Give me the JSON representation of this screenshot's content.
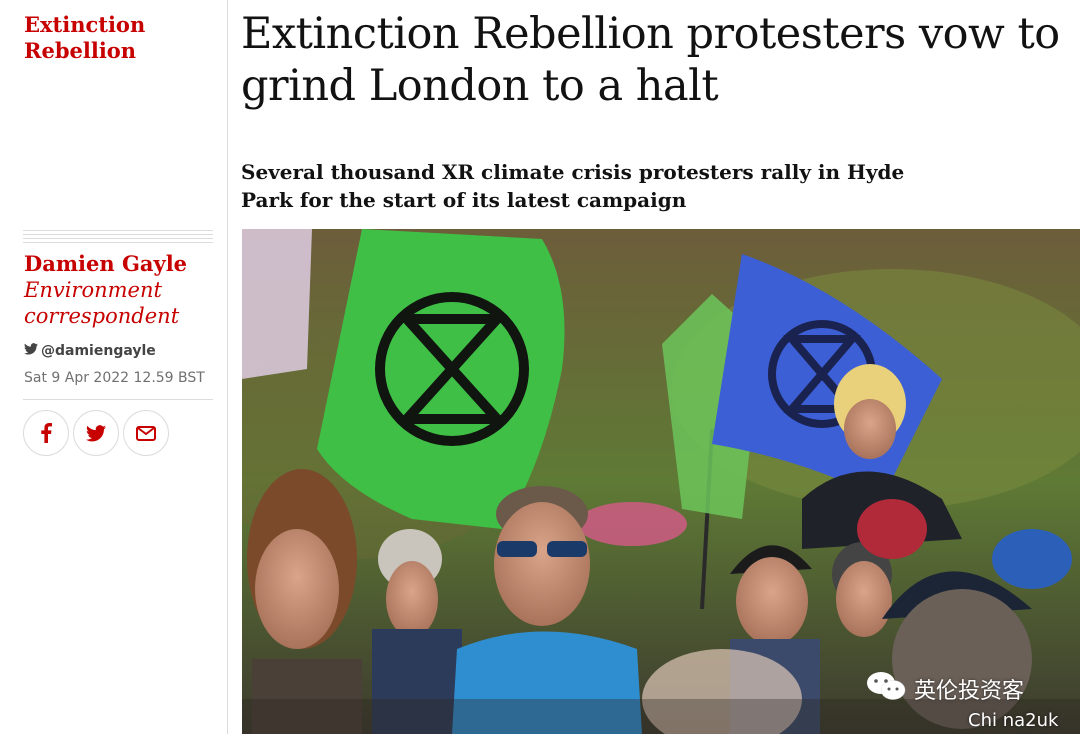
{
  "article": {
    "section": "Extinction Rebellion",
    "headline": "Extinction Rebellion protesters vow to grind London to a halt",
    "standfirst": "Several thousand XR climate crisis protesters rally in Hyde Park for the start of its latest campaign"
  },
  "byline": {
    "name": "Damien Gayle",
    "role": "Environment correspondent",
    "twitter": "@damiengayle",
    "date": "Sat 9 Apr 2022 12.59 BST"
  },
  "share": {
    "buttons": [
      "facebook-icon",
      "twitter-icon",
      "email-icon"
    ]
  },
  "colors": {
    "accent": "#c70000",
    "text": "#121212",
    "muted": "#707070",
    "xr_green": "#3fbf45",
    "xr_blue": "#3d5fd6"
  },
  "watermark": {
    "main": "英伦投资客",
    "sub": "Chi na2uk"
  }
}
